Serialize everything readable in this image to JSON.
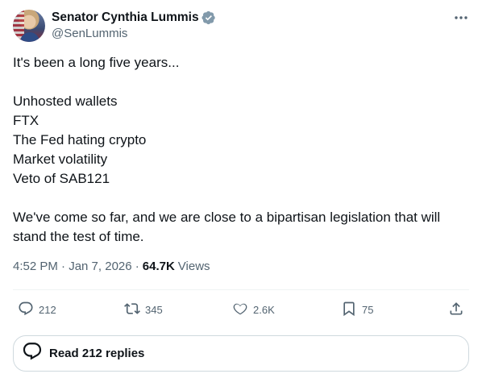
{
  "author": {
    "display_name": "Senator Cynthia Lummis",
    "handle": "@SenLummis",
    "verified_icon": "verified-badge-icon"
  },
  "tweet": {
    "lines": [
      "It's been a long five years...",
      "",
      "Unhosted wallets",
      "FTX",
      "The Fed hating crypto",
      "Market volatility",
      "Veto of SAB121",
      "",
      "We've come so far, and we are close to a bipartisan legislation that will",
      "stand the test of time."
    ]
  },
  "meta": {
    "timestamp": "4:52 PM · Jan 7, 2026 ·",
    "views_count": "64.7K",
    "views_label": "Views"
  },
  "actions": {
    "reply_count": "212",
    "repost_count": "345",
    "like_count": "2.6K",
    "bookmark_count": "75"
  },
  "replies_button": {
    "label": "Read 212 replies"
  },
  "colors": {
    "text_primary": "#0f1419",
    "text_secondary": "#536471",
    "verified": "#829aab",
    "border": "#cfd9de"
  }
}
